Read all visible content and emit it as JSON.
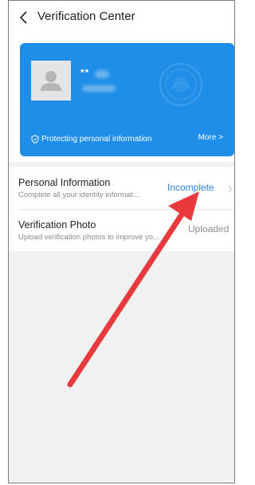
{
  "header": {
    "title": "Verification Center"
  },
  "hero": {
    "masked_name": "**",
    "protect_text": "Protecting personal information",
    "more_label": "More >"
  },
  "items": [
    {
      "title": "Personal Information",
      "subtitle": "Complete all your identity informat...",
      "status": "Incomplete"
    },
    {
      "title": "Verification Photo",
      "subtitle": "Upload verification photos to improve yo...",
      "status": "Uploaded"
    }
  ],
  "colors": {
    "hero_blue": "#1f8ee8",
    "status_incomplete": "#2a84d6",
    "annotation_arrow": "#e8393d"
  }
}
